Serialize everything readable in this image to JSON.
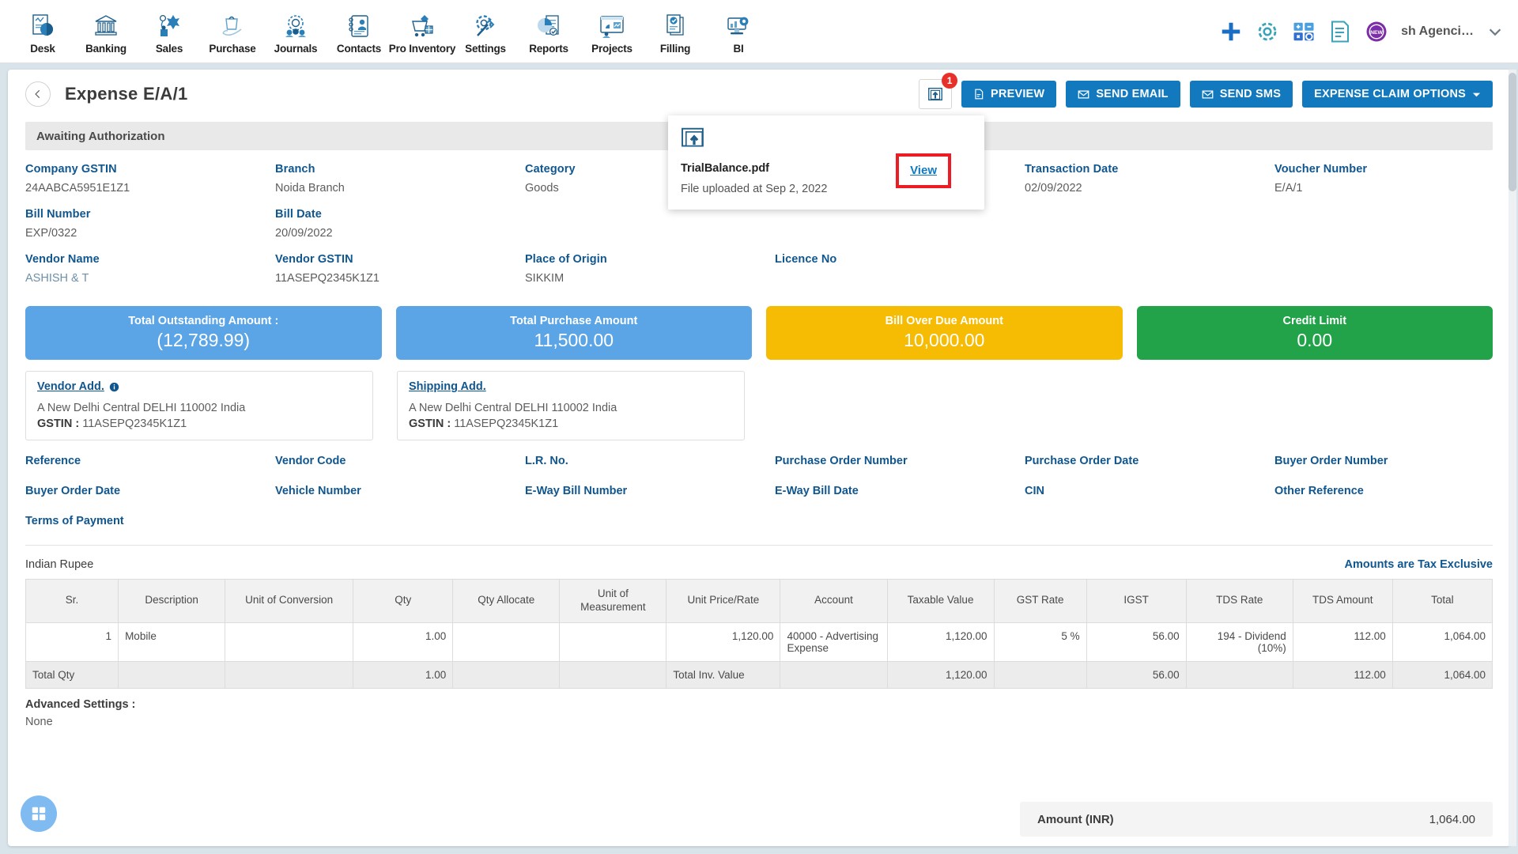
{
  "topnav": {
    "items": [
      {
        "label": "Desk",
        "icon": "desk-chart-icon"
      },
      {
        "label": "Banking",
        "icon": "bank-icon"
      },
      {
        "label": "Sales",
        "icon": "sales-icon"
      },
      {
        "label": "Purchase",
        "icon": "purchase-bag-icon"
      },
      {
        "label": "Journals",
        "icon": "journals-icon"
      },
      {
        "label": "Contacts",
        "icon": "contacts-book-icon"
      },
      {
        "label": "Pro Inventory",
        "icon": "inventory-cart-icon"
      },
      {
        "label": "Settings",
        "icon": "settings-gear-tools-icon"
      },
      {
        "label": "Reports",
        "icon": "reports-pie-icon"
      },
      {
        "label": "Projects",
        "icon": "projects-dashboard-icon"
      },
      {
        "label": "Filling",
        "icon": "filling-doc-icon"
      },
      {
        "label": "BI",
        "icon": "bi-monitor-icon"
      }
    ],
    "right_icons": [
      {
        "name": "add-plus-icon"
      },
      {
        "name": "settings-gear-icon"
      },
      {
        "name": "calculator-icon"
      },
      {
        "name": "notes-clipboard-icon"
      },
      {
        "name": "new-badge-icon",
        "text": "NEW"
      }
    ],
    "company": "…ish Agenci…",
    "chevron": "chevron-down-icon"
  },
  "header": {
    "back": "back-arrow-icon",
    "title": "Expense E/A/1",
    "attach_badge": "1",
    "buttons": [
      {
        "label": "PREVIEW",
        "icon": "pdf-file-icon"
      },
      {
        "label": "SEND EMAIL",
        "icon": "envelope-icon"
      },
      {
        "label": "SEND SMS",
        "icon": "envelope-icon"
      },
      {
        "label": "EXPENSE CLAIM OPTIONS",
        "icon": "caret-down-icon"
      }
    ]
  },
  "popover": {
    "icon": "file-upload-icon",
    "file_name": "TrialBalance.pdf",
    "meta": "File uploaded at Sep 2, 2022",
    "view_label": "View",
    "highlight_color": "#ec1c24"
  },
  "status": "Awaiting Authorization",
  "fields": {
    "row1": [
      {
        "label": "Company GSTIN",
        "value": "24AABCA5951E1Z1"
      },
      {
        "label": "Branch",
        "value": "Noida Branch"
      },
      {
        "label": "Category",
        "value": "Goods"
      },
      {
        "label": "",
        "value": ""
      },
      {
        "label": "Transaction Date",
        "value": "02/09/2022"
      },
      {
        "label": "Voucher Number",
        "value": "E/A/1"
      }
    ],
    "row2": [
      {
        "label": "Bill Number",
        "value": "EXP/0322"
      },
      {
        "label": "Bill Date",
        "value": "20/09/2022"
      },
      {
        "label": "",
        "value": ""
      },
      {
        "label": "",
        "value": ""
      },
      {
        "label": "",
        "value": ""
      },
      {
        "label": "",
        "value": ""
      }
    ],
    "row3": [
      {
        "label": "Vendor Name",
        "value": "ASHISH & T",
        "link": true
      },
      {
        "label": "Vendor GSTIN",
        "value": "11ASEPQ2345K1Z1"
      },
      {
        "label": "Place of Origin",
        "value": "SIKKIM"
      },
      {
        "label": "Licence No",
        "value": ""
      },
      {
        "label": "",
        "value": ""
      },
      {
        "label": "",
        "value": ""
      }
    ]
  },
  "cards": [
    {
      "title": "Total Outstanding Amount :",
      "value": "(12,789.99)",
      "color": "#5ba5e6"
    },
    {
      "title": "Total Purchase Amount",
      "value": "11,500.00",
      "color": "#5ba5e6"
    },
    {
      "title": "Bill Over Due Amount",
      "value": "10,000.00",
      "color": "#f6bb03"
    },
    {
      "title": "Credit Limit",
      "value": "0.00",
      "color": "#22a34a"
    }
  ],
  "addresses": [
    {
      "title": "Vendor Add.",
      "info_icon": "info-circle-icon",
      "line": "A New Delhi Central DELHI 110002 India",
      "gstin_label": "GSTIN :",
      "gstin": "11ASEPQ2345K1Z1"
    },
    {
      "title": "Shipping Add.",
      "info_icon": "",
      "line": "A New Delhi Central DELHI 110002 India",
      "gstin_label": "GSTIN :",
      "gstin": "11ASEPQ2345K1Z1"
    }
  ],
  "refs": {
    "row1": [
      "Reference",
      "Vendor Code",
      "L.R. No.",
      "Purchase Order Number",
      "Purchase Order Date",
      "Buyer Order Number"
    ],
    "row2": [
      "Buyer Order Date",
      "Vehicle Number",
      "E-Way Bill Number",
      "E-Way Bill Date",
      "CIN",
      "Other Reference"
    ],
    "row3": [
      "Terms of Payment",
      "",
      "",
      "",
      "",
      ""
    ]
  },
  "table_section": {
    "currency": "Indian Rupee",
    "tax_note": "Amounts are Tax Exclusive",
    "columns": [
      "Sr.",
      "Description",
      "Unit of Conversion",
      "Qty",
      "Qty Allocate",
      "Unit of Measurement",
      "Unit Price/Rate",
      "Account",
      "Taxable Value",
      "GST Rate",
      "IGST",
      "TDS Rate",
      "TDS Amount",
      "Total"
    ],
    "rows": [
      {
        "sr": "1",
        "description": "Mobile",
        "unit_of_conversion": "",
        "qty": "1.00",
        "qty_allocate": "",
        "unit_of_measurement": "",
        "unit_price": "1,120.00",
        "account": "40000 - Advertising Expense",
        "taxable_value": "1,120.00",
        "gst_rate": "5 %",
        "igst": "56.00",
        "tds_rate": "194 - Dividend (10%)",
        "tds_amount": "112.00",
        "total": "1,064.00"
      }
    ],
    "total_row": {
      "label": "Total Qty",
      "qty": "1.00",
      "inv_label": "Total Inv. Value",
      "taxable_value": "1,120.00",
      "igst": "56.00",
      "tds_amount": "112.00",
      "total": "1,064.00"
    }
  },
  "advanced": {
    "title": "Advanced Settings :",
    "value": "None"
  },
  "amount_bar": {
    "label": "Amount (INR)",
    "value": "1,064.00"
  },
  "fab": {
    "icon": "grid-apps-icon"
  }
}
